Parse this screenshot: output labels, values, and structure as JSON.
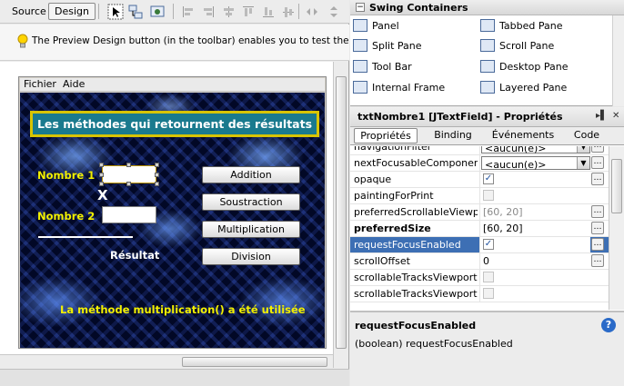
{
  "toolbar": {
    "source_label": "Source",
    "design_label": "Design"
  },
  "hint": {
    "text": "The Preview Design button (in the toolbar) enables you to test the desig"
  },
  "form": {
    "menu": [
      "Fichier",
      "Aide"
    ],
    "title": "Les méthodes qui retournent des résultats",
    "nombre1_label": "Nombre 1",
    "nombre2_label": "Nombre 2",
    "x_label": "X",
    "resultat_label": "Résultat",
    "buttons": [
      "Addition",
      "Soustraction",
      "Multiplication",
      "Division"
    ],
    "message": "La méthode multiplication() a été utilisée",
    "bg_color": "#05103a",
    "title_bg": "#1a7a8e",
    "accent_yellow": "#f3f000"
  },
  "palette": {
    "title": "Swing Containers",
    "items": [
      "Panel",
      "Tabbed Pane",
      "Split Pane",
      "Scroll Pane",
      "Tool Bar",
      "Desktop Pane",
      "Internal Frame",
      "Layered Pane"
    ]
  },
  "properties": {
    "title": "txtNombre1 [JTextField] - Propriétés",
    "tabs": [
      "Propriétés",
      "Binding",
      "Événements",
      "Code"
    ],
    "rows": [
      {
        "name": "navigationFilter",
        "value": "<aucun(e)>",
        "kind": "combo"
      },
      {
        "name": "nextFocusableComponent",
        "value": "<aucun(e)>",
        "kind": "combo"
      },
      {
        "name": "opaque",
        "value": "✓",
        "kind": "check"
      },
      {
        "name": "paintingForPrint",
        "value": "",
        "kind": "check-disabled"
      },
      {
        "name": "preferredScrollableViewport",
        "value": "[60, 20]",
        "kind": "gray"
      },
      {
        "name": "preferredSize",
        "value": "[60, 20]",
        "kind": "bold"
      },
      {
        "name": "requestFocusEnabled",
        "value": "✓",
        "kind": "check-selected"
      },
      {
        "name": "scrollOffset",
        "value": "0",
        "kind": "text"
      },
      {
        "name": "scrollableTracksViewportHe",
        "value": "",
        "kind": "check-disabled"
      },
      {
        "name": "scrollableTracksViewportWi",
        "value": "",
        "kind": "check-disabled"
      }
    ],
    "help_name": "requestFocusEnabled",
    "help_desc": "(boolean) requestFocusEnabled",
    "selection_color": "#3d6fb4"
  }
}
